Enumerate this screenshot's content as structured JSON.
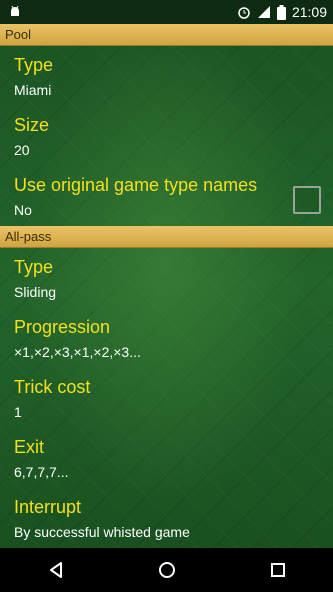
{
  "status_bar": {
    "icons_left": [
      "android-debug-icon"
    ],
    "icons_right": [
      "alarm-icon",
      "signal-icon",
      "battery-icon"
    ],
    "time": "21:09"
  },
  "sections": [
    {
      "header": "Pool",
      "items": [
        {
          "title": "Type",
          "summary": "Miami"
        },
        {
          "title": "Size",
          "summary": "20"
        },
        {
          "title": "Use original game type names",
          "summary": "No",
          "checkbox": false
        }
      ]
    },
    {
      "header": "All-pass",
      "items": [
        {
          "title": "Type",
          "summary": "Sliding"
        },
        {
          "title": "Progression",
          "summary": "×1,×2,×3,×1,×2,×3..."
        },
        {
          "title": "Trick cost",
          "summary": "1"
        },
        {
          "title": "Exit",
          "summary": "6,7,7,7..."
        },
        {
          "title": "Interrupt",
          "summary": "By successful whisted game"
        }
      ]
    }
  ],
  "nav_bar": {
    "buttons": [
      "back-icon",
      "home-icon",
      "recents-icon"
    ]
  },
  "colors": {
    "header_gold": "#dcb451",
    "title_yellow": "#f2e020",
    "felt_green": "#1d5a26"
  }
}
